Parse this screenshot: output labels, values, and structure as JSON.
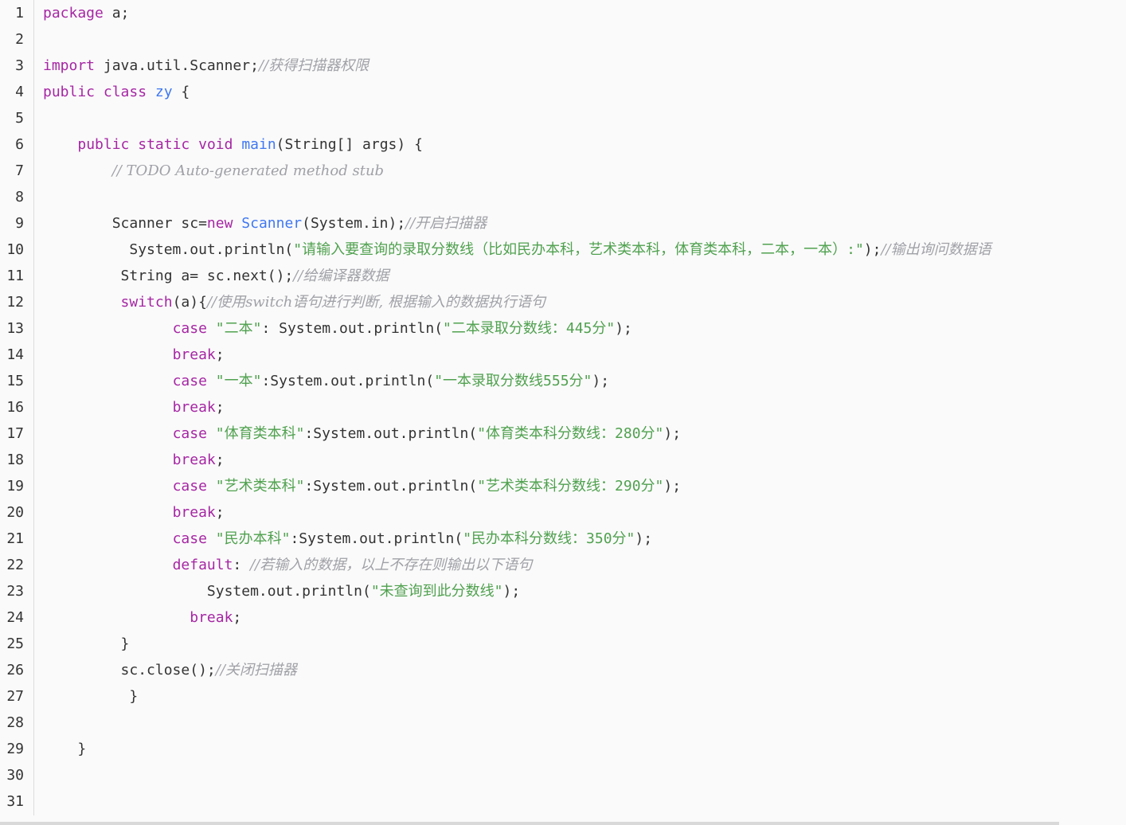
{
  "editor": {
    "lines": [
      {
        "number": "1",
        "tokens": [
          {
            "t": "kw",
            "v": "package"
          },
          {
            "t": "plain",
            "v": " a;"
          }
        ]
      },
      {
        "number": "2",
        "tokens": []
      },
      {
        "number": "3",
        "tokens": [
          {
            "t": "kw",
            "v": "import"
          },
          {
            "t": "plain",
            "v": " java.util.Scanner;"
          },
          {
            "t": "cmt",
            "v": "//获得扫描器权限"
          }
        ]
      },
      {
        "number": "4",
        "tokens": [
          {
            "t": "kw",
            "v": "public"
          },
          {
            "t": "plain",
            "v": " "
          },
          {
            "t": "kw",
            "v": "class"
          },
          {
            "t": "plain",
            "v": " "
          },
          {
            "t": "cls",
            "v": "zy"
          },
          {
            "t": "plain",
            "v": " {"
          }
        ]
      },
      {
        "number": "5",
        "tokens": []
      },
      {
        "number": "6",
        "tokens": [
          {
            "t": "plain",
            "v": "    "
          },
          {
            "t": "kw",
            "v": "public"
          },
          {
            "t": "plain",
            "v": " "
          },
          {
            "t": "kw",
            "v": "static"
          },
          {
            "t": "plain",
            "v": " "
          },
          {
            "t": "kw",
            "v": "void"
          },
          {
            "t": "plain",
            "v": " "
          },
          {
            "t": "fn",
            "v": "main"
          },
          {
            "t": "plain",
            "v": "(String[] args) {"
          }
        ]
      },
      {
        "number": "7",
        "tokens": [
          {
            "t": "plain",
            "v": "        "
          },
          {
            "t": "cmt",
            "v": "// TODO Auto-generated method stub"
          }
        ]
      },
      {
        "number": "8",
        "tokens": []
      },
      {
        "number": "9",
        "tokens": [
          {
            "t": "plain",
            "v": "        Scanner sc="
          },
          {
            "t": "kw",
            "v": "new"
          },
          {
            "t": "plain",
            "v": " "
          },
          {
            "t": "cls",
            "v": "Scanner"
          },
          {
            "t": "plain",
            "v": "(System.in);"
          },
          {
            "t": "cmt",
            "v": "//开启扫描器"
          }
        ]
      },
      {
        "number": "10",
        "tokens": [
          {
            "t": "plain",
            "v": "          System.out.println("
          },
          {
            "t": "str",
            "v": "\"请输入要查询的录取分数线（比如民办本科，艺术类本科，体育类本科，二本，一本）:\""
          },
          {
            "t": "plain",
            "v": ");"
          },
          {
            "t": "cmt",
            "v": "//输出询问数据语"
          }
        ]
      },
      {
        "number": "11",
        "tokens": [
          {
            "t": "plain",
            "v": "         String a= sc.next();"
          },
          {
            "t": "cmt",
            "v": "//给编译器数据"
          }
        ]
      },
      {
        "number": "12",
        "tokens": [
          {
            "t": "plain",
            "v": "         "
          },
          {
            "t": "kw",
            "v": "switch"
          },
          {
            "t": "plain",
            "v": "(a){"
          },
          {
            "t": "cmt",
            "v": "//使用switch语句进行判断, 根据输入的数据执行语句"
          }
        ]
      },
      {
        "number": "13",
        "tokens": [
          {
            "t": "plain",
            "v": "               "
          },
          {
            "t": "kw",
            "v": "case"
          },
          {
            "t": "plain",
            "v": " "
          },
          {
            "t": "str",
            "v": "\"二本\""
          },
          {
            "t": "plain",
            "v": ": System.out.println("
          },
          {
            "t": "str",
            "v": "\"二本录取分数线：445分\""
          },
          {
            "t": "plain",
            "v": ");"
          }
        ]
      },
      {
        "number": "14",
        "tokens": [
          {
            "t": "plain",
            "v": "               "
          },
          {
            "t": "kw",
            "v": "break"
          },
          {
            "t": "plain",
            "v": ";"
          }
        ]
      },
      {
        "number": "15",
        "tokens": [
          {
            "t": "plain",
            "v": "               "
          },
          {
            "t": "kw",
            "v": "case"
          },
          {
            "t": "plain",
            "v": " "
          },
          {
            "t": "str",
            "v": "\"一本\""
          },
          {
            "t": "plain",
            "v": ":System.out.println("
          },
          {
            "t": "str",
            "v": "\"一本录取分数线555分\""
          },
          {
            "t": "plain",
            "v": ");"
          }
        ]
      },
      {
        "number": "16",
        "tokens": [
          {
            "t": "plain",
            "v": "               "
          },
          {
            "t": "kw",
            "v": "break"
          },
          {
            "t": "plain",
            "v": ";"
          }
        ]
      },
      {
        "number": "17",
        "tokens": [
          {
            "t": "plain",
            "v": "               "
          },
          {
            "t": "kw",
            "v": "case"
          },
          {
            "t": "plain",
            "v": " "
          },
          {
            "t": "str",
            "v": "\"体育类本科\""
          },
          {
            "t": "plain",
            "v": ":System.out.println("
          },
          {
            "t": "str",
            "v": "\"体育类本科分数线：280分\""
          },
          {
            "t": "plain",
            "v": ");"
          }
        ]
      },
      {
        "number": "18",
        "tokens": [
          {
            "t": "plain",
            "v": "               "
          },
          {
            "t": "kw",
            "v": "break"
          },
          {
            "t": "plain",
            "v": ";"
          }
        ]
      },
      {
        "number": "19",
        "tokens": [
          {
            "t": "plain",
            "v": "               "
          },
          {
            "t": "kw",
            "v": "case"
          },
          {
            "t": "plain",
            "v": " "
          },
          {
            "t": "str",
            "v": "\"艺术类本科\""
          },
          {
            "t": "plain",
            "v": ":System.out.println("
          },
          {
            "t": "str",
            "v": "\"艺术类本科分数线：290分\""
          },
          {
            "t": "plain",
            "v": ");"
          }
        ]
      },
      {
        "number": "20",
        "tokens": [
          {
            "t": "plain",
            "v": "               "
          },
          {
            "t": "kw",
            "v": "break"
          },
          {
            "t": "plain",
            "v": ";"
          }
        ]
      },
      {
        "number": "21",
        "tokens": [
          {
            "t": "plain",
            "v": "               "
          },
          {
            "t": "kw",
            "v": "case"
          },
          {
            "t": "plain",
            "v": " "
          },
          {
            "t": "str",
            "v": "\"民办本科\""
          },
          {
            "t": "plain",
            "v": ":System.out.println("
          },
          {
            "t": "str",
            "v": "\"民办本科分数线：350分\""
          },
          {
            "t": "plain",
            "v": ");"
          }
        ]
      },
      {
        "number": "22",
        "tokens": [
          {
            "t": "plain",
            "v": "               "
          },
          {
            "t": "kw",
            "v": "default"
          },
          {
            "t": "plain",
            "v": ": "
          },
          {
            "t": "cmt",
            "v": "//若输入的数据，以上不存在则输出以下语句"
          }
        ]
      },
      {
        "number": "23",
        "tokens": [
          {
            "t": "plain",
            "v": "                   System.out.println("
          },
          {
            "t": "str",
            "v": "\"未查询到此分数线\""
          },
          {
            "t": "plain",
            "v": ");"
          }
        ]
      },
      {
        "number": "24",
        "tokens": [
          {
            "t": "plain",
            "v": "                 "
          },
          {
            "t": "kw",
            "v": "break"
          },
          {
            "t": "plain",
            "v": ";"
          }
        ]
      },
      {
        "number": "25",
        "tokens": [
          {
            "t": "plain",
            "v": "         }"
          }
        ]
      },
      {
        "number": "26",
        "tokens": [
          {
            "t": "plain",
            "v": "         sc.close();"
          },
          {
            "t": "cmt",
            "v": "//关闭扫描器"
          }
        ]
      },
      {
        "number": "27",
        "tokens": [
          {
            "t": "plain",
            "v": "          }"
          }
        ]
      },
      {
        "number": "28",
        "tokens": []
      },
      {
        "number": "29",
        "tokens": [
          {
            "t": "plain",
            "v": "    }"
          }
        ]
      },
      {
        "number": "30",
        "tokens": []
      },
      {
        "number": "31",
        "tokens": []
      }
    ]
  },
  "colors": {
    "keyword": "#a626a4",
    "class_name": "#4078f2",
    "string": "#50a14f",
    "comment": "#a0a1a7",
    "text": "#333333",
    "background": "#fafafa"
  }
}
